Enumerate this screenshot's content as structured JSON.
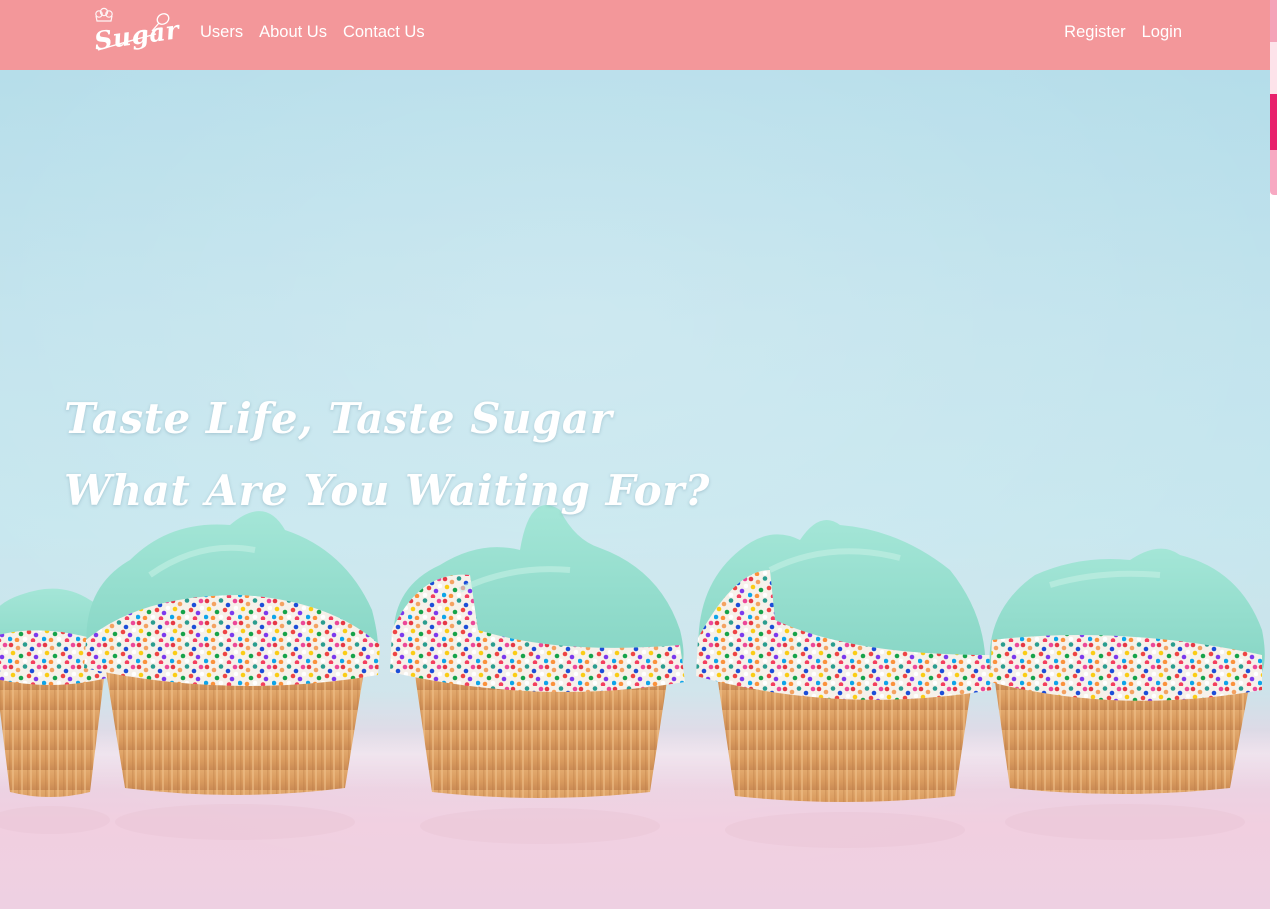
{
  "brand": {
    "logo_text": "Sugar",
    "logo_icon": "cupcake-chef-hat-icon"
  },
  "nav": {
    "left_links": [
      {
        "label": "Users"
      },
      {
        "label": "About Us"
      },
      {
        "label": "Contact Us"
      }
    ],
    "right_links": [
      {
        "label": "Register"
      },
      {
        "label": "Login"
      }
    ]
  },
  "hero": {
    "headline_line1": "Taste Life, Taste Sugar",
    "headline_line2": "What Are You Waiting For?",
    "background_image": "teal-frosted-cupcakes-with-rainbow-sprinkles"
  },
  "colors": {
    "navbar": "#f3979a",
    "frosting": "#8fdccb",
    "hero_sky": "#c6e6ef",
    "hero_floor": "#f1cfe0",
    "scroll_accent": "#e8216c"
  }
}
